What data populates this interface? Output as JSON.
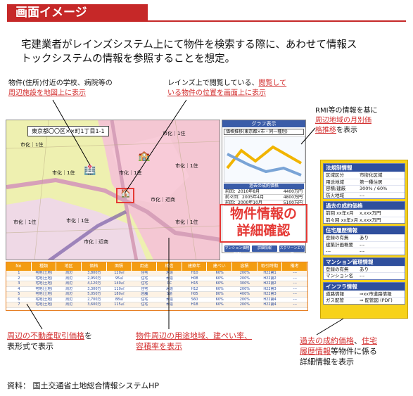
{
  "header": {
    "title": "画面イメージ"
  },
  "intro": {
    "line1": "宅建業者がレインズシステム上にて物件を検索する際に、あわせて情報ス",
    "line2": "トックシステムの情報を参照することを想定。"
  },
  "notes": {
    "facilities_a": "物件(住所)付近の学校、病院等の",
    "facilities_b": "周辺施設を地図上に表示",
    "position_a": "レインズ上で閲覧している、",
    "position_b": "閲覧して",
    "position_c": "いる物件の位置を画面上に表示",
    "trend_a": "RMI等の情報を基に",
    "trend_b": "周辺地域の月別価",
    "trend_c": "格推移",
    "trend_d": "を表示",
    "prices_a": "周辺の不動産取引価格",
    "prices_b": "を",
    "prices_c": "表形式で表示",
    "landuse_a": "物件周辺の用途地域、建ぺい率、",
    "landuse_b": "容積率を表示",
    "detail_a": "過去の成約価格",
    "detail_b": "、",
    "detail_c": "住宅",
    "detail_d": "履歴情報",
    "detail_e": "等物件に係る",
    "detail_f": "詳細情報を表示"
  },
  "map": {
    "address": "東京都〇〇区××町1丁目1-1",
    "zone_label": "市化",
    "zone_labels": [
      "市化｜1住",
      "市化｜1住",
      "市化｜1住",
      "市化｜1住",
      "市化｜1住",
      "市化｜1住",
      "市化｜近商",
      "市化｜近商",
      "市化｜1住",
      "市化｜1住"
    ]
  },
  "panel": {
    "title": "グラフ表示",
    "combo": "価格推移(東京都×市・同一種別)",
    "history_title": "過去の成約価格",
    "history": [
      {
        "label": "前回：2010年8月",
        "value": "4400万円"
      },
      {
        "label": "前々回：2005年4月",
        "value": "4800万円"
      },
      {
        "label": "前回：2000年10月",
        "value": "5100万円"
      }
    ],
    "buttons": [
      "マンション価格情報",
      "詳細情報",
      "スクリーンエリア"
    ]
  },
  "overlay": {
    "line1": "物件情報の",
    "line2": "詳細確認"
  },
  "infobox": {
    "sections": [
      {
        "title": "法規制情報",
        "rows": [
          [
            "区域区分",
            "市街化区域"
          ],
          [
            "用途地域",
            "第一種住居"
          ],
          [
            "容積/建蔽",
            "300% / 60%"
          ],
          [
            "防火地域",
            "---"
          ]
        ]
      },
      {
        "title": "過去の成約価格",
        "rows": [
          [
            "前回 xx年x月",
            "x,xxx万円"
          ],
          [
            "前々回 xx年x月",
            "x,xxx万円"
          ]
        ]
      },
      {
        "title": "住宅履歴情報",
        "rows": [
          [
            "登録の有無",
            "あり"
          ],
          [
            "建築計画概要",
            "---"
          ],
          [
            "---",
            "---"
          ]
        ]
      },
      {
        "title": "マンション管理情報",
        "rows": [
          [
            "登録の有無",
            "あり"
          ],
          [
            "マンション名",
            "---"
          ]
        ]
      },
      {
        "title": "インフラ情報",
        "rows": [
          [
            "道路情報",
            "⇒xx市道路情報"
          ],
          [
            "ガス配管",
            "⇒ 配管図 (PDF)"
          ]
        ]
      }
    ]
  },
  "table": {
    "headers": [
      "No",
      "種類",
      "地区",
      "価格",
      "面積",
      "用途",
      "構造",
      "建築年",
      "建ぺい",
      "容積",
      "取引時期",
      "備考"
    ],
    "rows": [
      [
        "1",
        "宅地(土地)",
        "周辺",
        "3,800万",
        "120㎡",
        "住宅",
        "木造",
        "H10",
        "60%",
        "200%",
        "H22第1",
        "---"
      ],
      [
        "2",
        "宅地(土地)",
        "周辺",
        "2,950万",
        "95㎡",
        "住宅",
        "木造",
        "H08",
        "60%",
        "200%",
        "H22第2",
        "---"
      ],
      [
        "3",
        "宅地(土地)",
        "周辺",
        "4,120万",
        "140㎡",
        "住宅",
        "RC",
        "H15",
        "60%",
        "300%",
        "H22第2",
        "---"
      ],
      [
        "4",
        "宅地(土地)",
        "周辺",
        "3,300万",
        "110㎡",
        "住宅",
        "木造",
        "H12",
        "60%",
        "200%",
        "H22第3",
        "---"
      ],
      [
        "5",
        "宅地(土地)",
        "周辺",
        "5,050万",
        "180㎡",
        "店舗",
        "S造",
        "H05",
        "80%",
        "400%",
        "H22第3",
        "---"
      ],
      [
        "6",
        "宅地(土地)",
        "周辺",
        "2,700万",
        "88㎡",
        "住宅",
        "木造",
        "S60",
        "60%",
        "200%",
        "H22第4",
        "---"
      ],
      [
        "7",
        "宅地(土地)",
        "周辺",
        "3,600万",
        "115㎡",
        "住宅",
        "木造",
        "H18",
        "60%",
        "200%",
        "H22第4",
        "---"
      ]
    ]
  },
  "source": "資料：  国土交通省土地総合情報システムHP"
}
